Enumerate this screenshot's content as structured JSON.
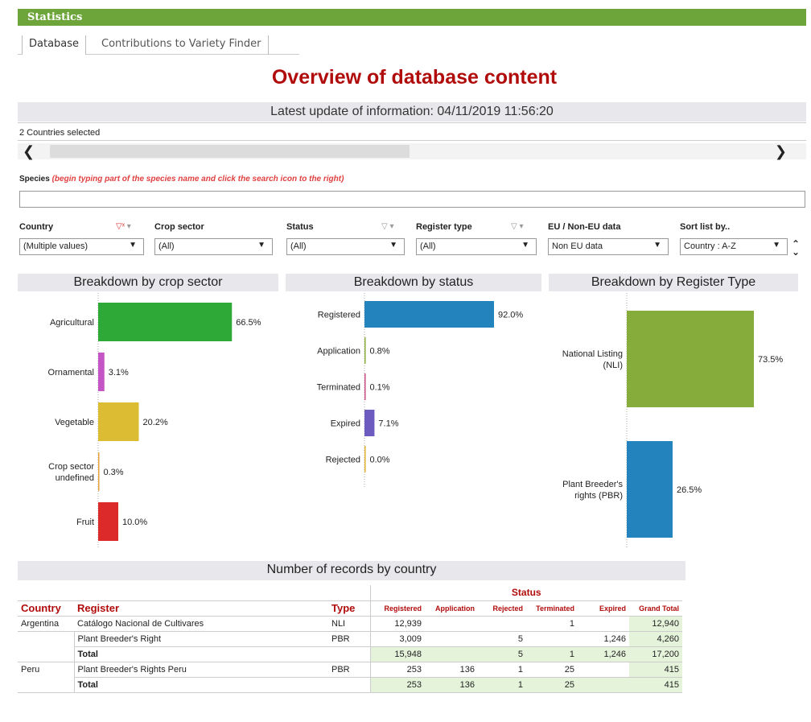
{
  "header": {
    "title": "Statistics"
  },
  "tabs": [
    {
      "label": "Database"
    },
    {
      "label": "Contributions to Variety Finder"
    }
  ],
  "main_title": "Overview of database content",
  "update_text": "Latest update of information: 04/11/2019 11:56:20",
  "countries_selected": "2 Countries selected",
  "species": {
    "label": "Species",
    "hint": "(begin typing part of the species name and click the search icon to the right)",
    "value": ""
  },
  "filters": {
    "country": {
      "label": "Country",
      "value": "(Multiple values)"
    },
    "crop_sector": {
      "label": "Crop sector",
      "value": "(All)"
    },
    "status": {
      "label": "Status",
      "value": "(All)"
    },
    "register_type": {
      "label": "Register type",
      "value": "(All)"
    },
    "eu": {
      "label": "EU / Non-EU data",
      "value": "Non EU data"
    },
    "sort": {
      "label": "Sort list by..",
      "value": "Country : A-Z"
    }
  },
  "chart_data": [
    {
      "type": "bar",
      "title": "Breakdown by crop sector",
      "orientation": "horizontal",
      "categories": [
        "Agricultural",
        "Ornamental",
        "Vegetable",
        "Crop sector|undefined",
        "Fruit"
      ],
      "values": [
        66.5,
        3.1,
        20.2,
        0.3,
        10.0
      ],
      "labels": [
        "66.5%",
        "3.1%",
        "20.2%",
        "0.3%",
        "10.0%"
      ],
      "colors": [
        "#2ea836",
        "#c455c4",
        "#dcbc32",
        "#e8a23a",
        "#dc2a2a"
      ]
    },
    {
      "type": "bar",
      "title": "Breakdown by status",
      "orientation": "horizontal",
      "categories": [
        "Registered",
        "Application",
        "Terminated",
        "Expired",
        "Rejected"
      ],
      "values": [
        92.0,
        0.8,
        0.1,
        7.1,
        0.0
      ],
      "labels": [
        "92.0%",
        "0.8%",
        "0.1%",
        "7.1%",
        "0.0%"
      ],
      "colors": [
        "#2283bd",
        "#8aae3a",
        "#c84f86",
        "#6e5bbf",
        "#e0b133"
      ]
    },
    {
      "type": "bar",
      "title": "Breakdown by Register Type",
      "orientation": "horizontal",
      "categories": [
        "National Listing|(NLI)",
        "Plant Breeder's|rights (PBR)"
      ],
      "values": [
        73.5,
        26.5
      ],
      "labels": [
        "73.5%",
        "26.5%"
      ],
      "colors": [
        "#86ad3c",
        "#2283bd"
      ]
    }
  ],
  "table": {
    "title": "Number of records by country",
    "status_header": "Status",
    "headers": {
      "country": "Country",
      "register": "Register",
      "type": "Type"
    },
    "status_cols": [
      "Registered",
      "Application",
      "Rejected",
      "Terminated",
      "Expired",
      "Grand Total"
    ],
    "rows": [
      {
        "country": "Argentina",
        "register": "Catálogo Nacional de Cultivares",
        "type": "NLI",
        "values": [
          "12,939",
          "",
          "",
          "1",
          "",
          "12,940"
        ],
        "total": false
      },
      {
        "country": "",
        "register": "Plant Breeder's Right",
        "type": "PBR",
        "values": [
          "3,009",
          "",
          "5",
          "",
          "1,246",
          "4,260"
        ],
        "total": false
      },
      {
        "country": "",
        "register": "Total",
        "type": "",
        "values": [
          "15,948",
          "",
          "5",
          "1",
          "1,246",
          "17,200"
        ],
        "total": true
      },
      {
        "country": "Peru",
        "register": "Plant Breeder's Rights Peru",
        "type": "PBR",
        "values": [
          "253",
          "136",
          "1",
          "25",
          "",
          "415"
        ],
        "total": false
      },
      {
        "country": "",
        "register": "Total",
        "type": "",
        "values": [
          "253",
          "136",
          "1",
          "25",
          "",
          "415"
        ],
        "total": true
      }
    ]
  }
}
